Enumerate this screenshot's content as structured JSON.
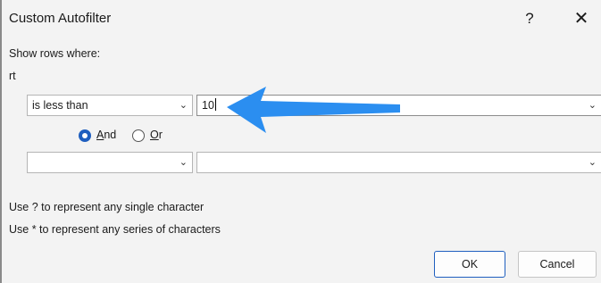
{
  "dialog": {
    "title": "Custom Autofilter",
    "help_label": "?",
    "close_label": "✕",
    "show_rows_label": "Show rows where:",
    "field_name": "rt"
  },
  "criteria": {
    "row1": {
      "operator": "is less than",
      "value": "10"
    },
    "row2": {
      "operator": "",
      "value": ""
    }
  },
  "logic": {
    "and_prefix": "",
    "and_accel": "A",
    "and_rest": "nd",
    "or_accel": "O",
    "or_rest": "r",
    "selected": "And"
  },
  "hints": {
    "single": "Use ? to represent any single character",
    "series": "Use * to represent any series of characters"
  },
  "buttons": {
    "ok": "OK",
    "cancel": "Cancel"
  },
  "colors": {
    "accent": "#1f5fbf",
    "arrow": "#2b8ef0"
  },
  "icons": {
    "caret": "chevron-down-icon",
    "annotation": "arrow-left-icon"
  }
}
